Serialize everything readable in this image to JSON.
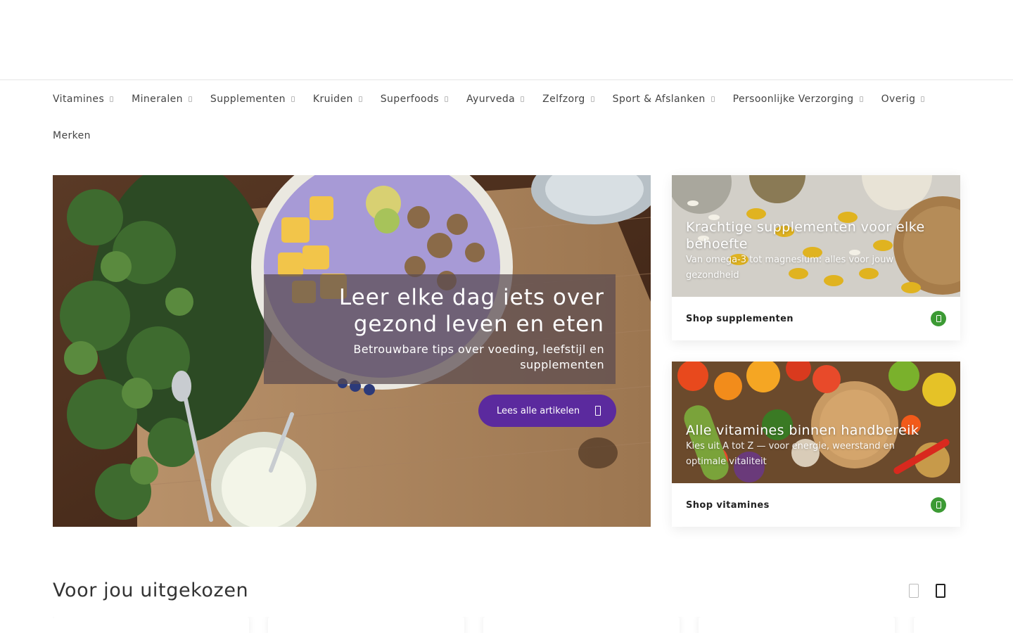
{
  "nav": {
    "items": [
      {
        "label": "Vitamines"
      },
      {
        "label": "Mineralen"
      },
      {
        "label": "Supplementen"
      },
      {
        "label": "Kruiden"
      },
      {
        "label": "Superfoods"
      },
      {
        "label": "Ayurveda"
      },
      {
        "label": "Zelfzorg"
      },
      {
        "label": "Sport & Afslanken"
      },
      {
        "label": "Persoonlijke Verzorging"
      },
      {
        "label": "Overig"
      }
    ],
    "merken": "Merken"
  },
  "hero": {
    "title_line1": "Leer elke dag iets over",
    "title_line2": "gezond leven en eten",
    "subtitle": "Betrouwbare tips over voeding, leefstijl en supplementen",
    "button_label": "Lees alle artikelen"
  },
  "cards": [
    {
      "title": "Krachtige supplementen voor elke behoefte",
      "subtitle": "Van omega-3 tot magnesium: alles voor jouw gezondheid",
      "link": "Shop supplementen"
    },
    {
      "title": "Alle vitamines binnen handbereik",
      "subtitle": "Kies uit A tot Z — voor energie, weerstand en optimale vitaliteit",
      "link": "Shop vitamines"
    }
  ],
  "section": {
    "title": "Voor jou uitgekozen"
  },
  "colors": {
    "accent_purple": "#5b2a9e",
    "accent_green": "#3c9a34"
  }
}
